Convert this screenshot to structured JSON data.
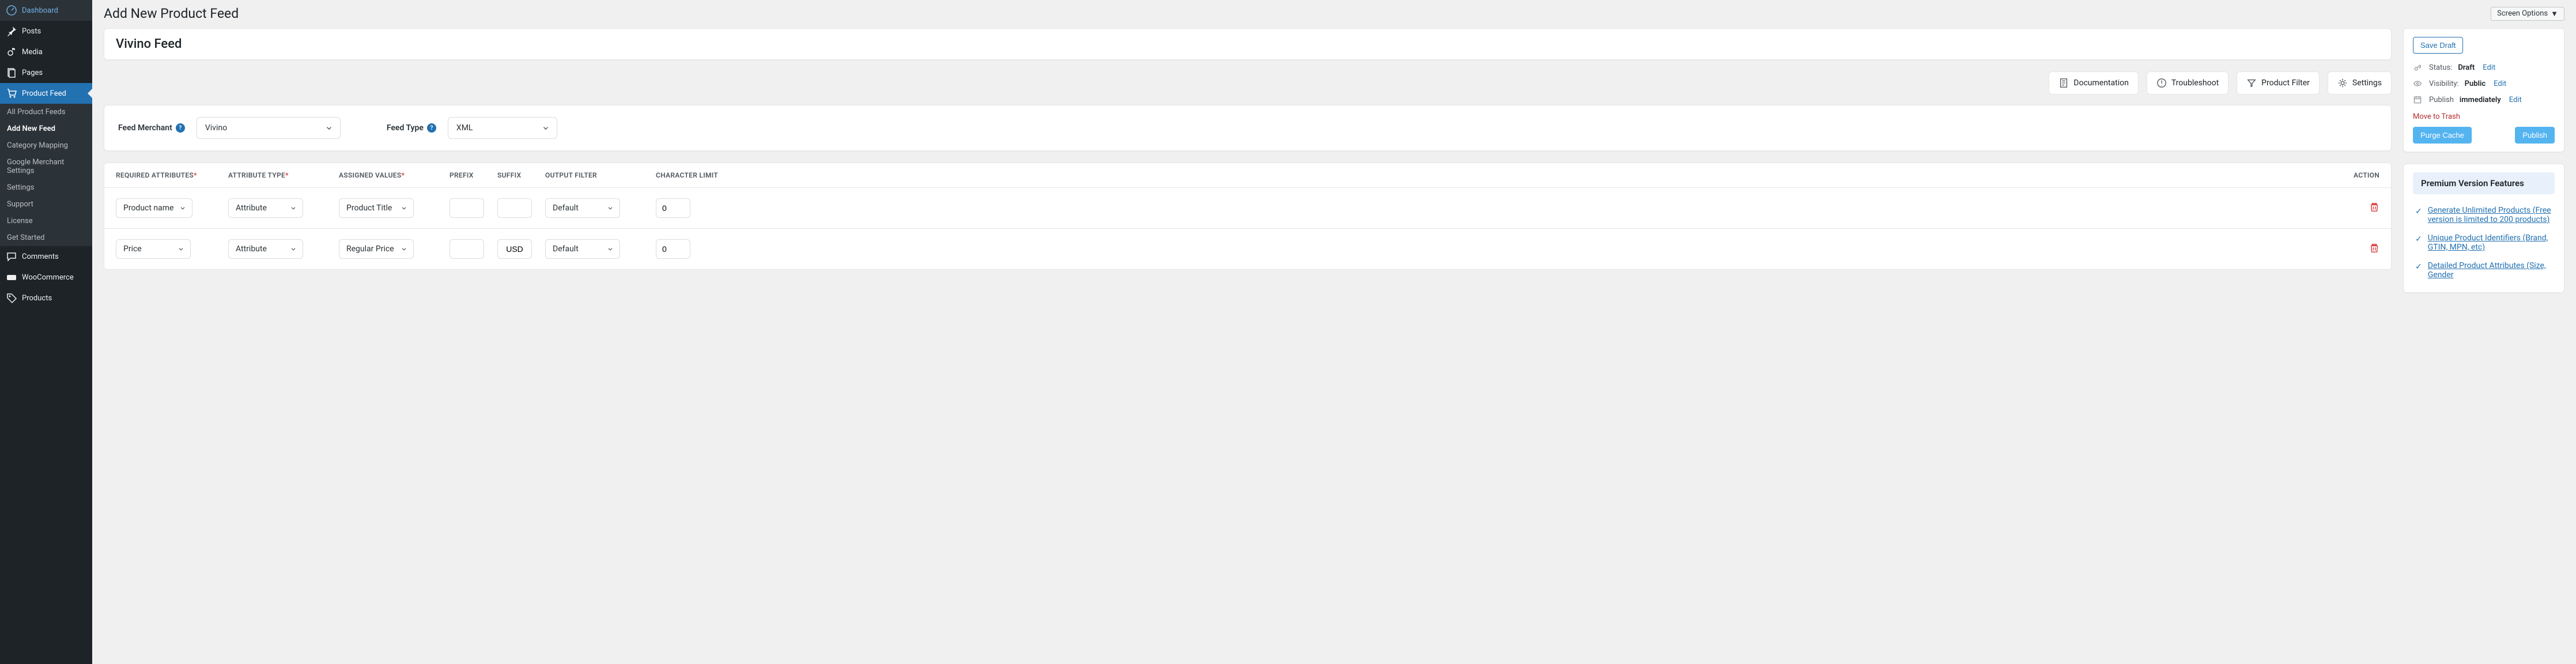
{
  "sidebar": {
    "items": [
      {
        "label": "Dashboard",
        "icon": "dashboard-icon"
      },
      {
        "label": "Posts",
        "icon": "pin-icon"
      },
      {
        "label": "Media",
        "icon": "media-icon"
      },
      {
        "label": "Pages",
        "icon": "pages-icon"
      },
      {
        "label": "Product Feed",
        "icon": "cart-icon",
        "active": true
      },
      {
        "label": "Comments",
        "icon": "comment-icon"
      },
      {
        "label": "WooCommerce",
        "icon": "woo-icon"
      },
      {
        "label": "Products",
        "icon": "tag-icon"
      }
    ],
    "sub": [
      {
        "label": "All Product Feeds"
      },
      {
        "label": "Add New Feed",
        "current": true
      },
      {
        "label": "Category Mapping"
      },
      {
        "label": "Google Merchant Settings"
      },
      {
        "label": "Settings"
      },
      {
        "label": "Support"
      },
      {
        "label": "License"
      },
      {
        "label": "Get Started"
      }
    ]
  },
  "header": {
    "title": "Add New Product Feed",
    "screen_options": "Screen Options"
  },
  "feed": {
    "title": "Vivino Feed"
  },
  "toolbar": {
    "documentation": "Documentation",
    "troubleshoot": "Troubleshoot",
    "product_filter": "Product Filter",
    "settings": "Settings"
  },
  "selectors": {
    "merchant_label": "Feed Merchant",
    "merchant_value": "Vivino",
    "type_label": "Feed Type",
    "type_value": "XML"
  },
  "table": {
    "headers": {
      "required": "REQUIRED ATTRIBUTES",
      "type": "ATTRIBUTE TYPE",
      "assigned": "ASSIGNED VALUES",
      "prefix": "PREFIX",
      "suffix": "SUFFIX",
      "filter": "OUTPUT FILTER",
      "limit": "CHARACTER LIMIT",
      "action": "ACTION"
    },
    "rows": [
      {
        "required": "Product name",
        "type": "Attribute",
        "assigned": "Product Title",
        "prefix": "",
        "suffix": "",
        "filter": "Default",
        "limit": "0"
      },
      {
        "required": "Price",
        "type": "Attribute",
        "assigned": "Regular Price",
        "prefix": "",
        "suffix": "USD",
        "filter": "Default",
        "limit": "0"
      }
    ]
  },
  "publish": {
    "save_draft": "Save Draft",
    "status_label": "Status:",
    "status_value": "Draft",
    "visibility_label": "Visibility:",
    "visibility_value": "Public",
    "publish_label": "Publish",
    "publish_value": "immediately",
    "edit": "Edit",
    "trash": "Move to Trash",
    "purge": "Purge Cache",
    "publish_btn": "Publish"
  },
  "premium": {
    "title": "Premium Version Features",
    "items": [
      "Generate Unlimited Products (Free version is limited to 200 products)",
      "Unique Product Identifiers (Brand, GTIN, MPN, etc)",
      "Detailed Product Attributes (Size, Gender"
    ]
  }
}
